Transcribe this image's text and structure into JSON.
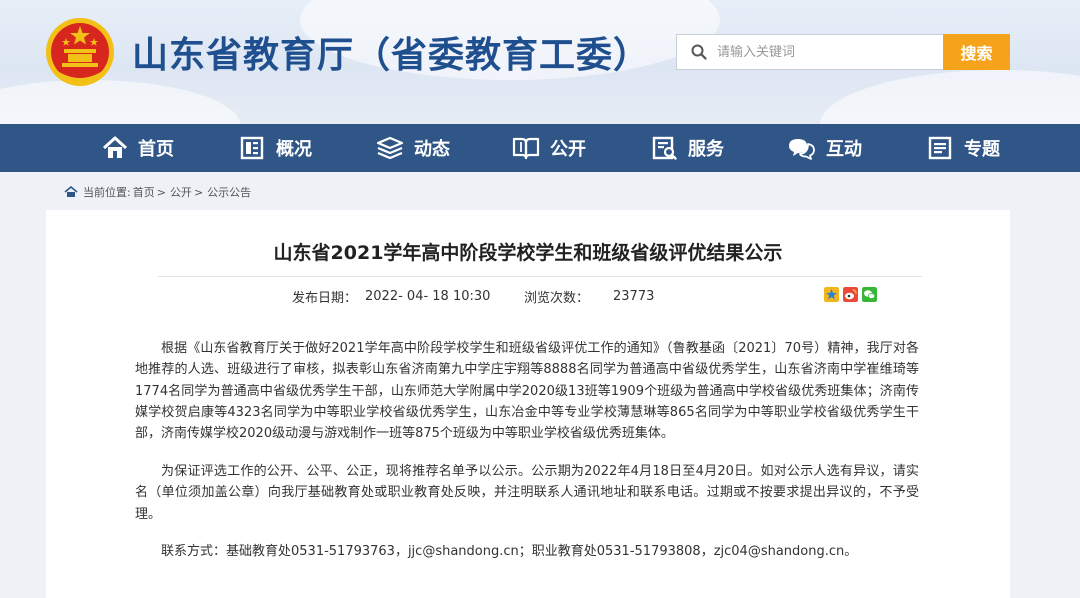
{
  "header": {
    "site_title": "山东省教育厅（省委教育工委）",
    "search_placeholder": "请输入关键词",
    "search_button": "搜索"
  },
  "nav": {
    "items": [
      {
        "label": "首页",
        "icon": "home-icon"
      },
      {
        "label": "概况",
        "icon": "overview-icon"
      },
      {
        "label": "动态",
        "icon": "news-stack-icon"
      },
      {
        "label": "公开",
        "icon": "open-book-icon"
      },
      {
        "label": "服务",
        "icon": "service-icon"
      },
      {
        "label": "互动",
        "icon": "chat-icon"
      },
      {
        "label": "专题",
        "icon": "topic-icon"
      }
    ]
  },
  "breadcrumb": {
    "prefix": "当前位置:",
    "items": [
      "首页",
      "公开",
      "公示公告"
    ],
    "separator": ">"
  },
  "article": {
    "title": "山东省2021学年高中阶段学校学生和班级省级评优结果公示",
    "date_label": "发布日期：",
    "date_value": "2022- 04- 18 10:30",
    "views_label": "浏览次数：",
    "views_value": "23773",
    "share_icons": [
      "qzone-share-icon",
      "weibo-share-icon",
      "wechat-share-icon"
    ],
    "paragraphs": [
      "根据《山东省教育厅关于做好2021学年高中阶段学校学生和班级省级评优工作的通知》（鲁教基函〔2021〕70号）精神，我厅对各地推荐的人选、班级进行了审核，拟表彰山东省济南第九中学庄宇翔等8888名同学为普通高中省级优秀学生，山东省济南中学崔维琦等1774名同学为普通高中省级优秀学生干部，山东师范大学附属中学2020级13班等1909个班级为普通高中学校省级优秀班集体；济南传媒学校贺启康等4323名同学为中等职业学校省级优秀学生，山东冶金中等专业学校薄慧琳等865名同学为中等职业学校省级优秀学生干部，济南传媒学校2020级动漫与游戏制作一班等875个班级为中等职业学校省级优秀班集体。",
      "为保证评选工作的公开、公平、公正，现将推荐名单予以公示。公示期为2022年4月18日至4月20日。如对公示人选有异议，请实名（单位须加盖公章）向我厅基础教育处或职业教育处反映，并注明联系人通讯地址和联系电话。过期或不按要求提出异议的，不予受理。",
      "联系方式：基础教育处0531-51793763，jjc@shandong.cn；职业教育处0531-51793808，zjc04@shandong.cn。"
    ]
  },
  "colors": {
    "nav_bg": "#2f5687",
    "title_blue": "#1f4f8f",
    "search_button": "#f5a31a",
    "emblem_red": "#d7261e",
    "emblem_gold": "#f3c018"
  }
}
